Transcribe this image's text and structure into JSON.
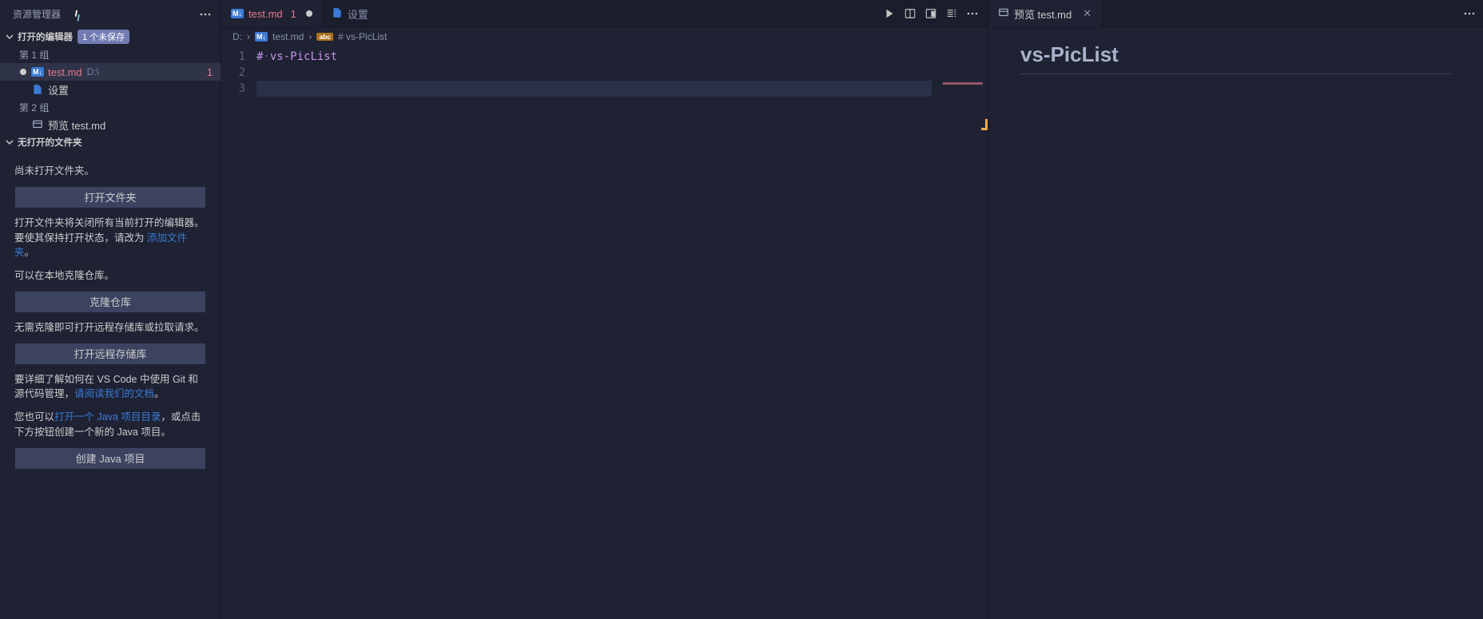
{
  "sidebar": {
    "title": "资源管理器",
    "open_editors_label": "打开的编辑器",
    "unsaved_badge": "1 个未保存",
    "group1_label": "第 1 组",
    "group2_label": "第 2 组",
    "file_test": "test.md",
    "file_test_path": "D:\\",
    "file_test_count": "1",
    "file_settings": "设置",
    "file_preview": "预览 test.md",
    "no_folder_label": "无打开的文件夹",
    "text_not_open": "尚未打开文件夹。",
    "btn_open_folder": "打开文件夹",
    "text_open_folder_warn_a": "打开文件夹将关闭所有当前打开的编辑器。要使其保持打开状态，请改为 ",
    "link_add_folder": "添加文件夹",
    "text_open_folder_warn_b": "。",
    "text_can_clone": "可以在本地克隆仓库。",
    "btn_clone": "克隆仓库",
    "text_no_clone": "无需克隆即可打开远程存储库或拉取请求。",
    "btn_open_remote": "打开远程存储库",
    "text_git_a": "要详细了解如何在 VS Code 中使用 Git 和源代码管理，",
    "link_git_docs": "请阅读我们的文档",
    "text_git_b": "。",
    "text_java_a": "您也可以",
    "link_java_open": "打开一个 Java 项目目录",
    "text_java_b": "，或点击下方按钮创建一个新的 Java 项目。",
    "btn_create_java": "创建 Java 项目"
  },
  "editor": {
    "tab1_label": "test.md",
    "tab1_count": "1",
    "tab2_label": "设置",
    "bc_drive": "D:",
    "bc_file": "test.md",
    "bc_symbol": "# vs-PicList",
    "line1_hash": "#",
    "line1_text": "vs-PicList",
    "ln1": "1",
    "ln2": "2",
    "ln3": "3"
  },
  "preview": {
    "tab_label": "预览 test.md",
    "heading": "vs-PicList"
  }
}
